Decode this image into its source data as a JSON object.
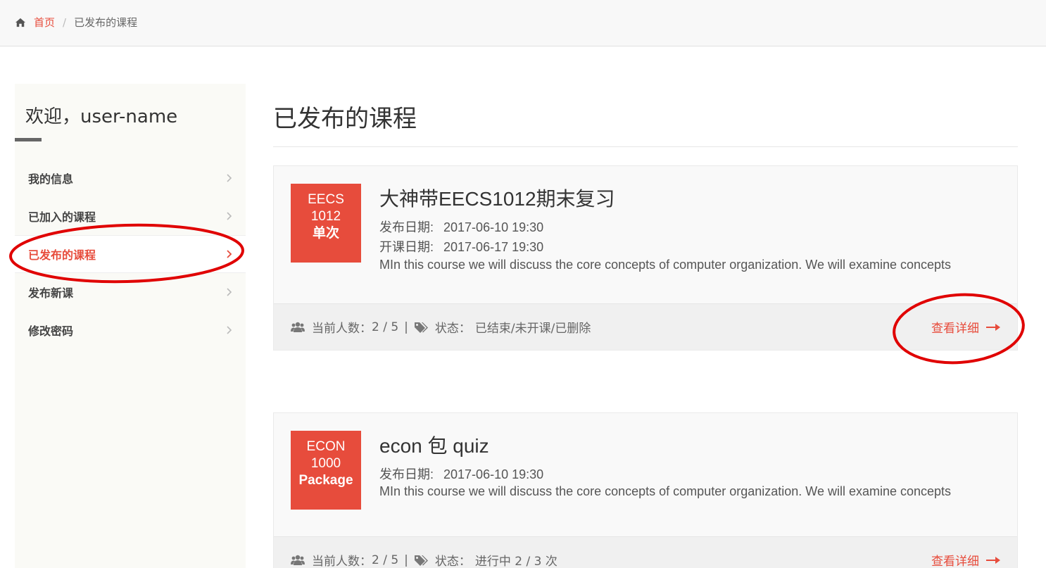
{
  "breadcrumb": {
    "home": "首页",
    "separator": "/",
    "current": "已发布的课程"
  },
  "sidebar": {
    "welcome": "欢迎，user-name",
    "items": [
      {
        "label": "我的信息",
        "active": false
      },
      {
        "label": "已加入的课程",
        "active": false
      },
      {
        "label": "已发布的课程",
        "active": true
      },
      {
        "label": "发布新课",
        "active": false
      },
      {
        "label": "修改密码",
        "active": false
      }
    ]
  },
  "main": {
    "title": "已发布的课程",
    "courses": [
      {
        "thumb": [
          "EECS",
          "1012",
          "单次"
        ],
        "title": "大神带EECS1012期末复习",
        "publish_label": "发布日期:",
        "publish_date": "2017-06-10 19:30",
        "start_label": "开课日期:",
        "start_date": "2017-06-17 19:30",
        "desc": "MIn this course we will discuss the core concepts of computer organization. We will examine concepts",
        "count_label": "当前人数：",
        "count": "2 / 5",
        "divider": "|",
        "status_label": "状态：",
        "status": "已结束/未开课/已删除",
        "detail": "查看详细"
      },
      {
        "thumb": [
          "ECON",
          "1000",
          "Package"
        ],
        "title": "econ 包 quiz",
        "publish_label": "发布日期:",
        "publish_date": "2017-06-10 19:30",
        "desc": "MIn this course we will discuss the core concepts of computer organization. We will examine concepts",
        "count_label": "当前人数：",
        "count": "2 / 5",
        "divider": "|",
        "status_label": "状态：",
        "status": "进行中 2 / 3 次",
        "detail": "查看详细"
      }
    ]
  },
  "colors": {
    "accent": "#e74c3c",
    "annotation": "#e00000"
  },
  "icons": {
    "home": "home-icon",
    "chevron": "chevron-right-icon",
    "users": "users-icon",
    "tags": "tags-icon",
    "arrow": "arrow-right-icon"
  }
}
